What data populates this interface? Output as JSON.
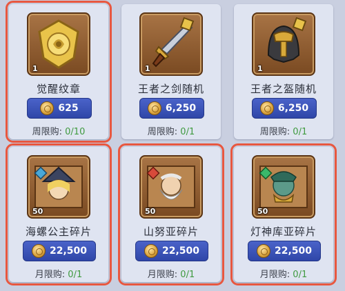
{
  "items": [
    {
      "name": "觉醒纹章",
      "qty": "1",
      "price": "625",
      "limit_label": "周限购:",
      "limit_value": "0/10",
      "highlighted": true,
      "icon": "awakening-emblem-icon"
    },
    {
      "name": "王者之剑随机",
      "qty": "1",
      "price": "6,250",
      "limit_label": "周限购:",
      "limit_value": "0/1",
      "highlighted": false,
      "icon": "kings-sword-icon"
    },
    {
      "name": "王者之盔随机",
      "qty": "1",
      "price": "6,250",
      "limit_label": "周限购:",
      "limit_value": "0/1",
      "highlighted": false,
      "icon": "kings-helmet-icon"
    },
    {
      "name": "海螺公主碎片",
      "qty": "50",
      "price": "22,500",
      "limit_label": "月限购:",
      "limit_value": "0/1",
      "highlighted": true,
      "icon": "conch-princess-shard-icon"
    },
    {
      "name": "山努亚碎片",
      "qty": "50",
      "price": "22,500",
      "limit_label": "月限购:",
      "limit_value": "0/1",
      "highlighted": true,
      "icon": "shannuya-shard-icon"
    },
    {
      "name": "灯神库亚碎片",
      "qty": "50",
      "price": "22,500",
      "limit_label": "月限购:",
      "limit_value": "0/1",
      "highlighted": true,
      "icon": "genie-kuya-shard-icon"
    }
  ],
  "colors": {
    "highlight": "#e8573f",
    "price_bg": "#3a52b8",
    "limit_count": "#3f9a3f"
  }
}
